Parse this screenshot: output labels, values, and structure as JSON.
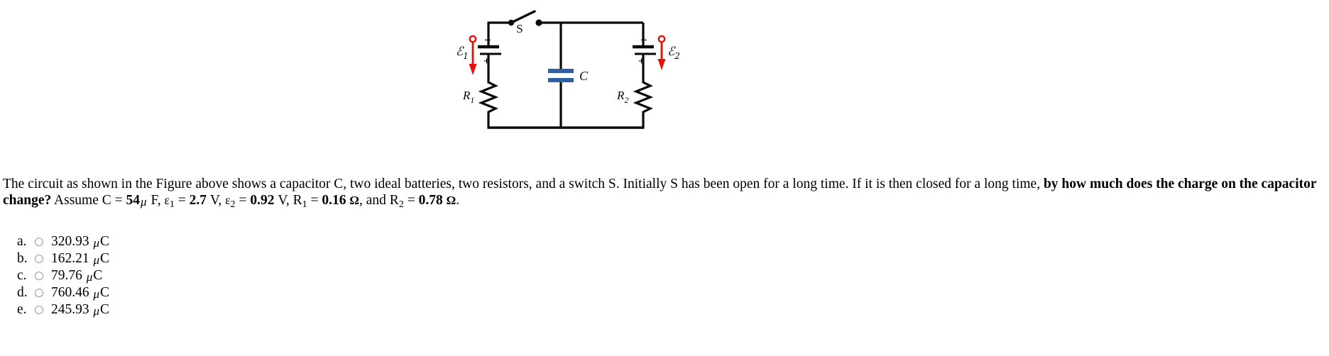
{
  "figure": {
    "labels": {
      "switch": "S",
      "capacitor": "C",
      "emf1": "ℰ",
      "emf1_sub": "1",
      "emf2": "ℰ",
      "emf2_sub": "2",
      "resistor1": "R",
      "resistor1_sub": "1",
      "resistor2": "R",
      "resistor2_sub": "2",
      "battery1_minus": "−",
      "battery1_plus": "+",
      "battery2_minus": "−",
      "battery2_plus": "+"
    },
    "colors": {
      "wire": "#0a0a0a",
      "emf_arrow": "#e8120a",
      "capacitor_plate": "#2e5fa3",
      "background": "#ffffff"
    }
  },
  "question": {
    "part1": "The circuit as shown in the Figure above shows a capacitor C, two ideal batteries, two resistors, and a switch S. Initially S has been open for a long time. If it is then closed for a long time, ",
    "bold1": "by how much does the charge on the capacitor change?",
    "part2": " Assume C = ",
    "capacitance_value": "54",
    "mu": "μ",
    "farad_unit": " F, ",
    "eps1_symbol": "ε",
    "eps1_sub": "1",
    "eq1": " = ",
    "eps1_value": "2.7",
    "volt1": " V, ",
    "eps2_symbol": "ε",
    "eps2_sub": "2",
    "eq2": " = ",
    "eps2_value": "0.92",
    "volt2": " V, R",
    "r1_sub": "1",
    "eq3": " = ",
    "r1_value": "0.16",
    "ohm1": "Ω",
    "and_text": ", and R",
    "r2_sub": "2",
    "eq4": " = ",
    "r2_value": "0.78",
    "ohm2": "Ω",
    "period": "."
  },
  "options": [
    {
      "letter": "a.",
      "value": "320.93",
      "unit_mu": "μ",
      "unit": "C",
      "selected": false
    },
    {
      "letter": "b.",
      "value": "162.21",
      "unit_mu": "μ",
      "unit": "C",
      "selected": false
    },
    {
      "letter": "c.",
      "value": "79.76",
      "unit_mu": "μ",
      "unit": "C",
      "selected": false
    },
    {
      "letter": "d.",
      "value": "760.46",
      "unit_mu": "μ",
      "unit": "C",
      "selected": false
    },
    {
      "letter": "e.",
      "value": "245.93",
      "unit_mu": "μ",
      "unit": "C",
      "selected": false
    }
  ]
}
